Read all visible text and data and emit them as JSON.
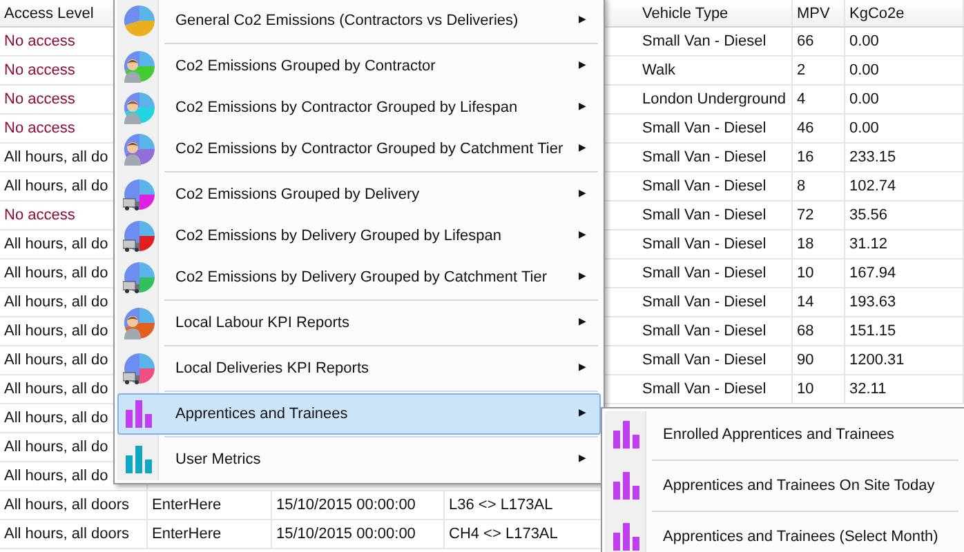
{
  "table": {
    "header": {
      "access_level": "Access Level",
      "vehicle_type": "Vehicle Type",
      "mpv": "MPV",
      "kgco2e": "KgCo2e"
    },
    "rows": [
      {
        "access_level": "No access",
        "access_denied": true,
        "vehicle_type": "Small Van - Diesel",
        "mpv": "66",
        "kgco2e": "0.00"
      },
      {
        "access_level": "No access",
        "access_denied": true,
        "vehicle_type": "Walk",
        "mpv": "2",
        "kgco2e": "0.00"
      },
      {
        "access_level": "No access",
        "access_denied": true,
        "vehicle_type": "London Underground",
        "mpv": "4",
        "kgco2e": "0.00"
      },
      {
        "access_level": "No access",
        "access_denied": true,
        "vehicle_type": "Small Van - Diesel",
        "mpv": "46",
        "kgco2e": "0.00"
      },
      {
        "access_level": "All hours, all do",
        "access_denied": false,
        "vehicle_type": "Small Van - Diesel",
        "mpv": "16",
        "kgco2e": "233.15"
      },
      {
        "access_level": "All hours, all do",
        "access_denied": false,
        "vehicle_type": "Small Van - Diesel",
        "mpv": "8",
        "kgco2e": "102.74"
      },
      {
        "access_level": "No access",
        "access_denied": true,
        "vehicle_type": "Small Van - Diesel",
        "mpv": "72",
        "kgco2e": "35.56"
      },
      {
        "access_level": "All hours, all do",
        "access_denied": false,
        "vehicle_type": "Small Van - Diesel",
        "mpv": "18",
        "kgco2e": "31.12"
      },
      {
        "access_level": "All hours, all do",
        "access_denied": false,
        "vehicle_type": "Small Van - Diesel",
        "mpv": "10",
        "kgco2e": "167.94"
      },
      {
        "access_level": "All hours, all do",
        "access_denied": false,
        "vehicle_type": "Small Van - Diesel",
        "mpv": "14",
        "kgco2e": "193.63"
      },
      {
        "access_level": "All hours, all do",
        "access_denied": false,
        "vehicle_type": "Small Van - Diesel",
        "mpv": "68",
        "kgco2e": "151.15"
      },
      {
        "access_level": "All hours, all do",
        "access_denied": false,
        "vehicle_type": "Small Van - Diesel",
        "mpv": "90",
        "kgco2e": "1200.31"
      },
      {
        "access_level": "All hours, all do",
        "access_denied": false,
        "vehicle_type": "Small Van - Diesel",
        "mpv": "10",
        "kgco2e": "32.11"
      },
      {
        "access_level": "All hours, all do",
        "access_denied": false
      },
      {
        "access_level": "All hours, all do",
        "access_denied": false
      },
      {
        "access_level": "All hours, all do",
        "access_denied": false
      },
      {
        "access_level": "All hours, all doors",
        "access_denied": false,
        "column_2": "EnterHere",
        "column_3": "15/10/2015 00:00:00",
        "column_4": "L36 <> L173AL"
      },
      {
        "access_level": "All hours, all doors",
        "access_denied": false,
        "column_2": "EnterHere",
        "column_3": "15/10/2015 00:00:00",
        "column_4": "CH4 <> L173AL"
      }
    ]
  },
  "context_menu": {
    "items": [
      {
        "label": "General Co2 Emissions (Contractors vs Deliveries)",
        "kind": "pie",
        "color": "#e8b020",
        "separator_before": false,
        "selected": false,
        "arrow": "▶"
      },
      {
        "label": "Co2 Emissions Grouped by Contractor",
        "kind": "contractor",
        "color": "#44cc33",
        "separator_before": true,
        "selected": false,
        "arrow": "▶"
      },
      {
        "label": "Co2 Emissions by Contractor Grouped by Lifespan",
        "kind": "contractor",
        "color": "#22d4e0",
        "separator_before": false,
        "selected": false,
        "arrow": "▶"
      },
      {
        "label": "Co2 Emissions by Contractor Grouped by Catchment Tier",
        "kind": "contractor",
        "color": "#9070d8",
        "separator_before": false,
        "selected": false,
        "arrow": "▶"
      },
      {
        "label": "Co2 Emissions Grouped by Delivery",
        "kind": "delivery",
        "color": "#e020e0",
        "separator_before": true,
        "selected": false,
        "arrow": "▶"
      },
      {
        "label": "Co2 Emissions by Delivery Grouped by Lifespan",
        "kind": "delivery",
        "color": "#e02020",
        "separator_before": false,
        "selected": false,
        "arrow": "▶"
      },
      {
        "label": "Co2 Emissions by Delivery Grouped by Catchment Tier",
        "kind": "delivery",
        "color": "#30c060",
        "separator_before": false,
        "selected": false,
        "arrow": "▶"
      },
      {
        "label": "Local Labour KPI Reports",
        "kind": "contractor",
        "color": "#e06020",
        "separator_before": true,
        "selected": false,
        "arrow": "▶"
      },
      {
        "label": "Local Deliveries KPI Reports",
        "kind": "delivery",
        "color": "#f05080",
        "separator_before": true,
        "selected": false,
        "arrow": "▶"
      },
      {
        "label": "Apprentices and Trainees",
        "kind": "bars",
        "color": "#c040f0",
        "separator_before": true,
        "selected": true,
        "arrow": "▶"
      },
      {
        "label": "User Metrics",
        "kind": "bars",
        "color": "#10a8c0",
        "separator_before": true,
        "selected": false,
        "arrow": "▶"
      }
    ]
  },
  "submenu": {
    "items": [
      {
        "label": "Enrolled Apprentices and Trainees",
        "kind": "bars",
        "color": "#c040f0",
        "separator_before": false
      },
      {
        "label": "Apprentices and Trainees On Site Today",
        "kind": "bars",
        "color": "#c040f0",
        "separator_before": true
      },
      {
        "label": "Apprentices and Trainees (Select Month)",
        "kind": "bars",
        "color": "#c040f0",
        "separator_before": true
      }
    ]
  }
}
